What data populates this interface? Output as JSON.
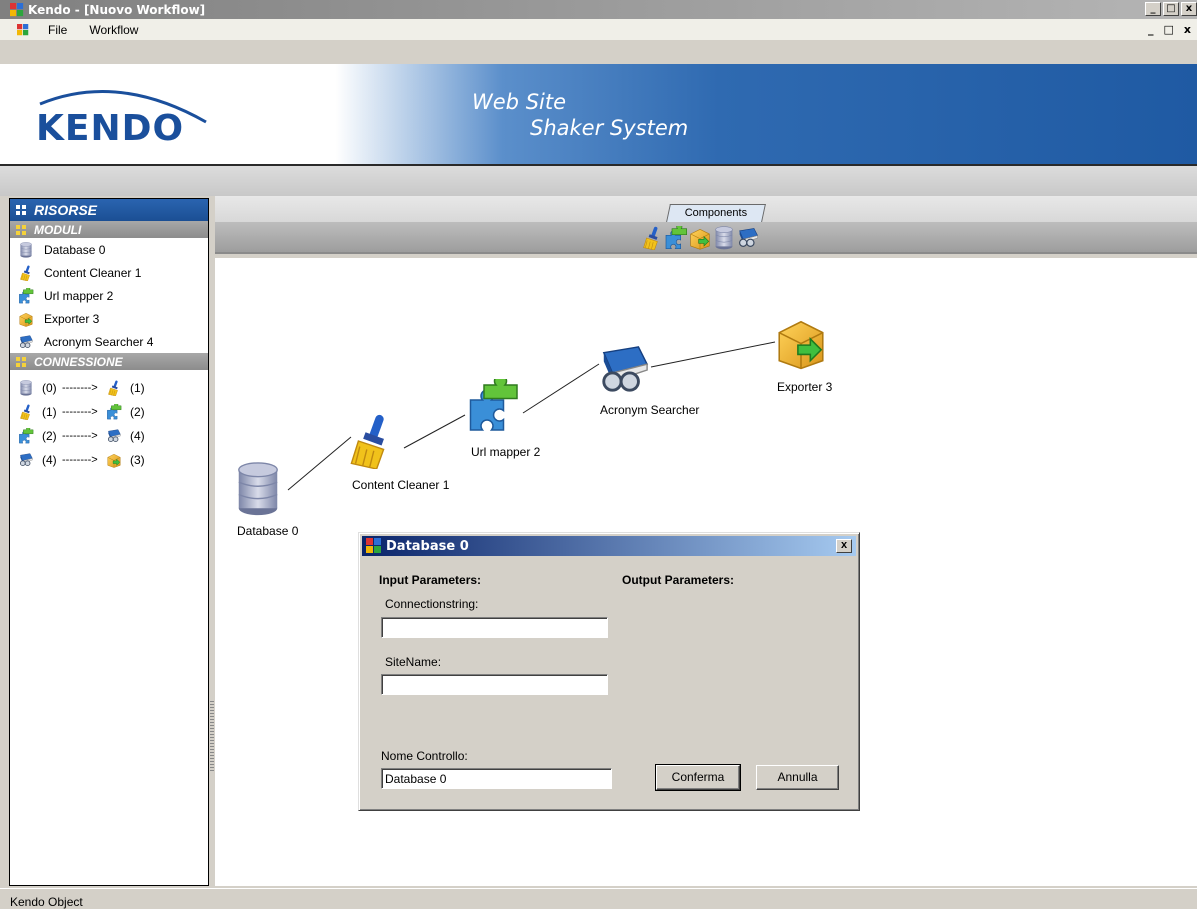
{
  "window": {
    "title": "Kendo - [Nuovo Workflow]",
    "controls": [
      "_",
      "□",
      "x"
    ]
  },
  "menu": {
    "items": [
      "File",
      "Workflow"
    ],
    "mdi_controls": [
      "_",
      "□",
      "x"
    ]
  },
  "banner": {
    "logo_text": "KENDO",
    "slogan_line1": "Web Site",
    "slogan_line2": "Shaker System",
    "colors": {
      "brand_blue": "#1f5aa3",
      "logo_blue": "#1a4f9c"
    }
  },
  "sidebar": {
    "title": "RISORSE",
    "modules_header": "MODULI",
    "modules": [
      {
        "icon": "database-icon",
        "label": "Database 0"
      },
      {
        "icon": "broom-icon",
        "label": "Content Cleaner 1"
      },
      {
        "icon": "puzzle-icon",
        "label": "Url mapper 2"
      },
      {
        "icon": "box-export-icon",
        "label": "Exporter 3"
      },
      {
        "icon": "book-binoculars-icon",
        "label": "Acronym Searcher 4"
      }
    ],
    "connections_header": "CONNESSIONE",
    "connections": [
      {
        "from_icon": "database-icon",
        "from": "(0)",
        "arrow": "-------->",
        "to_icon": "broom-icon",
        "to": "(1)"
      },
      {
        "from_icon": "broom-icon",
        "from": "(1)",
        "arrow": "-------->",
        "to_icon": "puzzle-icon",
        "to": "(2)"
      },
      {
        "from_icon": "puzzle-icon",
        "from": "(2)",
        "arrow": "-------->",
        "to_icon": "book-binoculars-icon",
        "to": "(4)"
      },
      {
        "from_icon": "book-binoculars-icon",
        "from": "(4)",
        "arrow": "-------->",
        "to_icon": "box-export-icon",
        "to": "(3)"
      }
    ]
  },
  "components": {
    "tab_label": "Components",
    "toolbar_icons": [
      "broom-icon",
      "puzzle-icon",
      "box-export-icon",
      "database-icon",
      "book-binoculars-icon"
    ]
  },
  "workflow": {
    "nodes": [
      {
        "name": "database-node",
        "label": "Database 0",
        "icon": "database-icon"
      },
      {
        "name": "content-cleaner-node",
        "label": "Content Cleaner 1",
        "icon": "broom-icon"
      },
      {
        "name": "url-mapper-node",
        "label": "Url mapper 2",
        "icon": "puzzle-icon"
      },
      {
        "name": "acronym-searcher-node",
        "label": "Acronym Searcher",
        "icon": "book-binoculars-icon"
      },
      {
        "name": "exporter-node",
        "label": "Exporter 3",
        "icon": "box-export-icon"
      }
    ]
  },
  "dialog": {
    "title": "Database 0",
    "close": "x",
    "input_heading": "Input Parameters:",
    "output_heading": "Output Parameters:",
    "connectionstring_label": "Connectionstring:",
    "connectionstring_value": "",
    "sitename_label": "SiteName:",
    "sitename_value": "",
    "nome_controllo_label": "Nome Controllo:",
    "nome_controllo_value": "Database 0",
    "confirm_label": "Conferma",
    "cancel_label": "Annulla"
  },
  "status": {
    "text": "Kendo Object"
  }
}
